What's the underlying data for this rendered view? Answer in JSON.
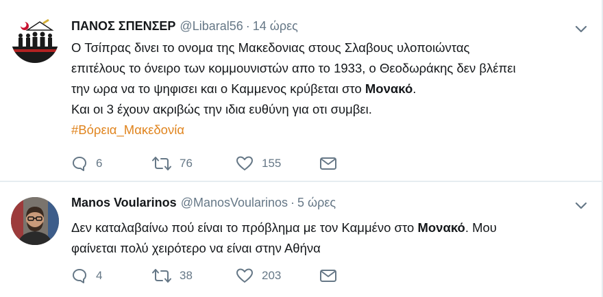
{
  "tweets": [
    {
      "name": "ΠΑΝΟΣ ΣΠΕΝΣΕΡ",
      "handle": "@Libaral56",
      "separator": "·",
      "time": "14 ώρες",
      "lines": [
        {
          "text": "Ο Τσίπρας δινει το ονομα της Μακεδονιας στους Σλαβους υλοποιώντας",
          "bold": "",
          "after": ""
        },
        {
          "text": "επιτέλους το όνειρο των κομμουνιστών απο το 1933, ο Θεοδωράκης δεν βλέπει",
          "bold": "",
          "after": ""
        },
        {
          "text": "την ωρα να το ψηφισει και ο Καμμενος κρύβεται στο ",
          "bold": "Μονακό",
          "after": "."
        },
        {
          "text": "Και οι 3 έχουν ακριβώς την ιδια ευθύνη για οτι συμβει.",
          "bold": "",
          "after": ""
        }
      ],
      "hashtag": "#Βόρεια_Μακεδονία",
      "replies": "6",
      "retweets": "76",
      "likes": "155"
    },
    {
      "name": "Manos Voularinos",
      "handle": "@ManosVoularinos",
      "separator": "·",
      "time": "5 ώρες",
      "lines": [
        {
          "text": "Δεν καταλαβαίνω πού είναι το πρόβλημα με τον Καμμένο στο ",
          "bold": "Μονακό",
          "after": ". Μου"
        },
        {
          "text": "φαίνεται πολύ χειρότερο να είναι στην Αθήνα",
          "bold": "",
          "after": ""
        }
      ],
      "replies": "4",
      "retweets": "38",
      "likes": "203"
    }
  ],
  "icons": {
    "reply": "reply-icon",
    "retweet": "retweet-icon",
    "like": "heart-icon",
    "message": "direct-message-icon",
    "more": "chevron-down-icon"
  },
  "colors": {
    "text": "#14171a",
    "secondary": "#657786",
    "hashtag": "#e0841e",
    "divider": "#e6ecf0"
  }
}
